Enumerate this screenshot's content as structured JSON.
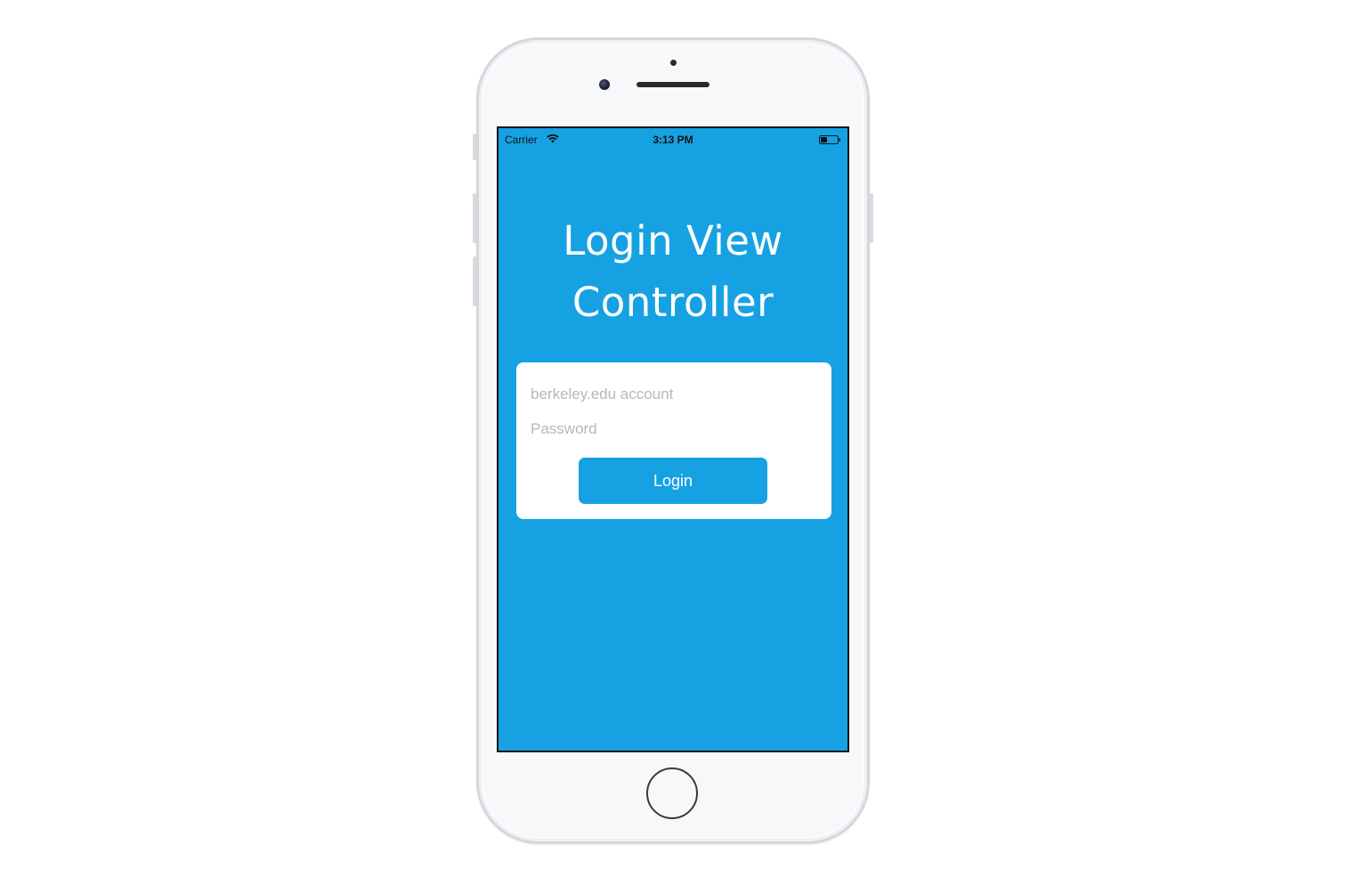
{
  "status_bar": {
    "carrier": "Carrier",
    "time": "3:13 PM",
    "wifi_icon": "wifi-icon",
    "battery_icon": "battery-icon"
  },
  "screen": {
    "background_color": "#16a1e3",
    "title_line1": "Login View",
    "title_line2": "Controller"
  },
  "login_form": {
    "account_placeholder": "berkeley.edu account",
    "account_value": "",
    "password_placeholder": "Password",
    "password_value": "",
    "login_label": "Login",
    "button_color": "#16a1e3"
  },
  "device": {
    "home_button_icon": "home-button-icon"
  }
}
